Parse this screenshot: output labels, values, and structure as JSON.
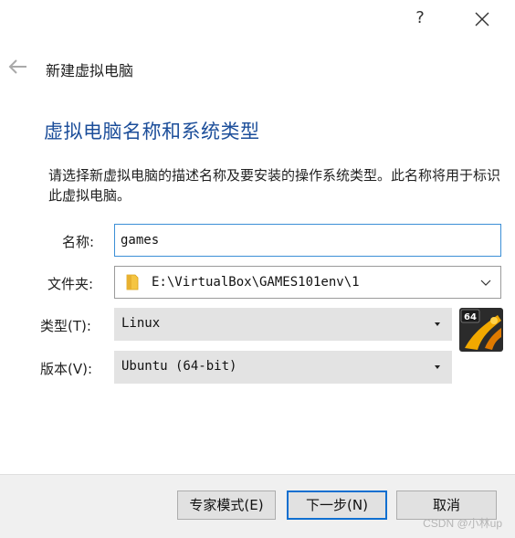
{
  "titlebar": {
    "help_label": "?"
  },
  "wizard": {
    "title": "新建虚拟电脑",
    "heading": "虚拟电脑名称和系统类型",
    "description": "请选择新虚拟电脑的描述名称及要安装的操作系统类型。此名称将用于标识此虚拟电脑。"
  },
  "form": {
    "name_label": "名称:",
    "name_value": "games",
    "folder_label": "文件夹:",
    "folder_value": "E:\\VirtualBox\\GAMES101env\\1",
    "type_label": "类型(T):",
    "type_value": "Linux",
    "version_label": "版本(V):",
    "version_value": "Ubuntu (64-bit)",
    "os_badge_text": "64"
  },
  "footer": {
    "expert_mode_label": "专家模式(E)",
    "next_label": "下一步(N)",
    "cancel_label": "取消",
    "watermark": "CSDN @小林up"
  },
  "colors": {
    "heading": "#1c4e9a",
    "focus_border": "#3b8fd6",
    "default_button_border": "#0f6fd0"
  }
}
